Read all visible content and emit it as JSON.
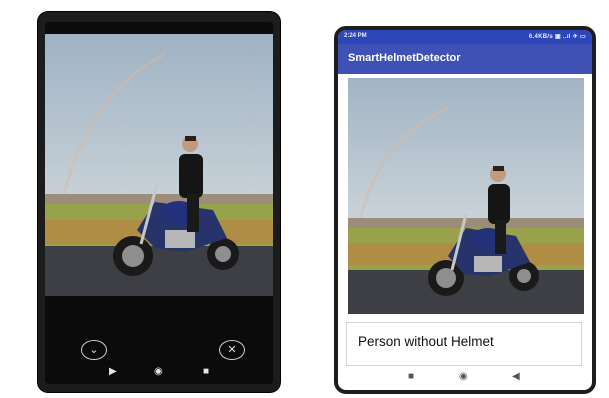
{
  "left_phone": {
    "controls": {
      "retake_icon": "chevron-down-icon",
      "cancel_icon": "close-icon"
    },
    "nav_icons": [
      "back-triangle-icon",
      "home-dot-icon",
      "recents-square-icon"
    ]
  },
  "right_phone": {
    "status_bar": {
      "time": "2:24 PM",
      "indicators": "6.4KB/s ▣ ..ıl ✈ ▭"
    },
    "app_title": "SmartHelmetDetector",
    "result_text": "Person without Helmet",
    "nav_icons": [
      "recents-square-icon",
      "home-dot-icon",
      "back-arrow-icon"
    ]
  },
  "colors": {
    "app_bar": "#3f51b5",
    "status_bar": "#2d47b8",
    "phone_frame": "#1c1c1c"
  },
  "photo_subject": "motorcycle-rider-image"
}
